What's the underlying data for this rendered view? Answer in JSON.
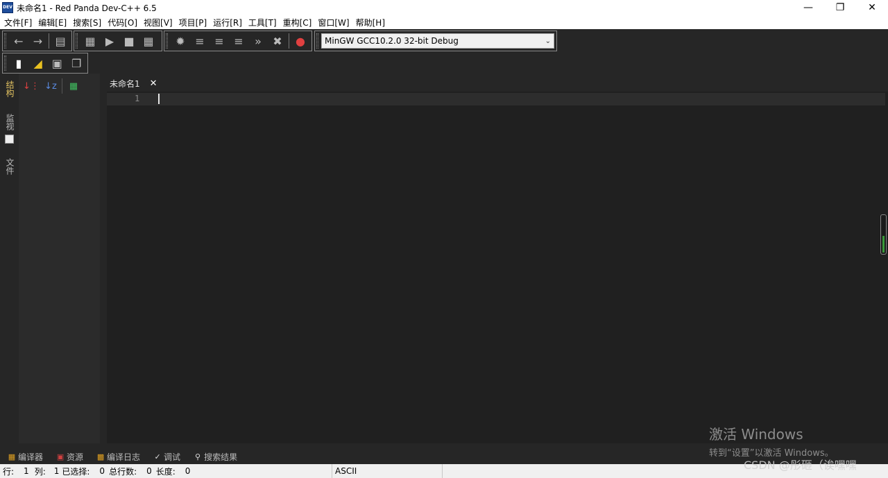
{
  "window": {
    "title": "未命名1 - Red Panda Dev-C++ 6.5",
    "icon_label": "DEV",
    "controls": [
      "minimize-icon",
      "restore-icon",
      "close-icon"
    ]
  },
  "menu": [
    "文件[F]",
    "编辑[E]",
    "搜索[S]",
    "代码[O]",
    "视图[V]",
    "项目[P]",
    "运行[R]",
    "工具[T]",
    "重构[C]",
    "窗口[W]",
    "帮助[H]"
  ],
  "toolbar": {
    "compiler_select": "MinGW GCC10.2.0 32-bit Debug"
  },
  "left_vertical_tabs": [
    "结构",
    "监视",
    "文件"
  ],
  "editor": {
    "tab_label": "未命名1",
    "line_number": "1"
  },
  "bottom_tabs": [
    "编译器",
    "资源",
    "编译日志",
    "调试",
    "搜索结果"
  ],
  "status": {
    "row_label": "行:",
    "row_value": "1",
    "col_label": "列:",
    "col_value": "1",
    "selected_label": "已选择:",
    "selected_value": "0",
    "total_lines_label": "总行数:",
    "total_lines_value": "0",
    "length_label": "长度:",
    "length_value": "0",
    "encoding": "ASCII"
  },
  "watermark": {
    "activate_title": "激活 Windows",
    "activate_sub": "转到“设置”以激活 Windows。",
    "csdn": "CSDN @彤砸（诶嘿嘿"
  },
  "colors": {
    "background": "#262626",
    "editor_bg": "#202020",
    "accent_active_tab": "#e0c060"
  }
}
